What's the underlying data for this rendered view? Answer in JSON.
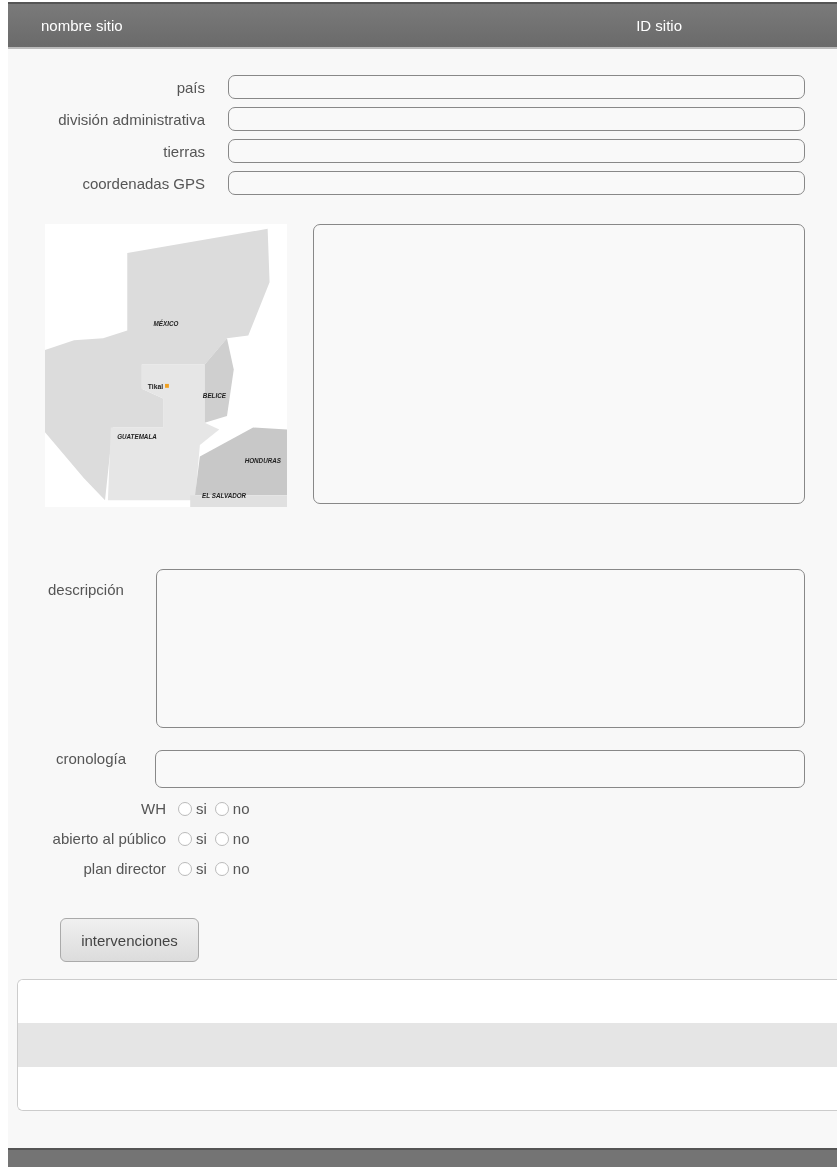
{
  "header": {
    "title": "nombre sitio",
    "id_label": "ID sitio"
  },
  "fields": [
    {
      "label": "país"
    },
    {
      "label": "división administrativa"
    },
    {
      "label": "tierras"
    },
    {
      "label": "coordenadas GPS"
    }
  ],
  "map": {
    "labels": [
      {
        "text": "MÉXICO",
        "kind": "country"
      },
      {
        "text": "Tikal",
        "kind": "site"
      },
      {
        "text": "BELICE",
        "kind": "country"
      },
      {
        "text": "GUATEMALA",
        "kind": "country"
      },
      {
        "text": "HONDURAS",
        "kind": "country"
      },
      {
        "text": "EL SALVADOR",
        "kind": "country"
      }
    ]
  },
  "description": {
    "label": "descripción"
  },
  "chronology": {
    "label": "cronología"
  },
  "options": [
    {
      "label": "WH",
      "choices": [
        {
          "label": "si",
          "selected": false
        },
        {
          "label": "no",
          "selected": false
        }
      ]
    },
    {
      "label": "abierto al público",
      "choices": [
        {
          "label": "si",
          "selected": false
        },
        {
          "label": "no",
          "selected": false
        }
      ]
    },
    {
      "label": "plan director",
      "choices": [
        {
          "label": "si",
          "selected": false
        },
        {
          "label": "no",
          "selected": false
        }
      ]
    }
  ],
  "button": {
    "label": "intervenciones"
  },
  "list": {
    "rows": [
      {
        "selected": false
      },
      {
        "selected": true
      },
      {
        "selected": false
      }
    ]
  }
}
